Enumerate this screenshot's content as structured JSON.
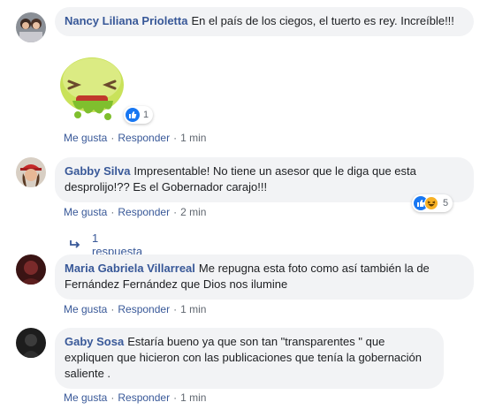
{
  "comments": [
    {
      "author": "Nancy Liliana Prioletta",
      "text": "En el país de los ciegos, el tuerto es rey. Increíble!!!",
      "sticker": "sick-face-sticker",
      "reaction_count": "1",
      "like": "Me gusta",
      "reply": "Responder",
      "time": "1 min"
    },
    {
      "author": "Gabby Silva",
      "text": "Impresentable! No tiene un asesor que le diga que esta desprolijo!?? Es el Gobernador carajo!!!",
      "reaction_count": "5",
      "like": "Me gusta",
      "reply": "Responder",
      "time": "2 min",
      "replies_label": "1 respuesta"
    },
    {
      "author": "Maria Gabriela Villarreal",
      "text": "Me repugna esta foto como así también la de Fernández Fernández que Dios nos ilumine",
      "like": "Me gusta",
      "reply": "Responder",
      "time": "1 min"
    },
    {
      "author": "Gaby Sosa",
      "text": "Estaría bueno ya que son tan \"transparentes \" que expliquen que hicieron con las publicaciones que tenía la gobernación saliente .",
      "like": "Me gusta",
      "reply": "Responder",
      "time": "1 min"
    }
  ],
  "colors": {
    "bubble": "#f2f3f5",
    "author": "#385898",
    "like_blue": "#1877f2",
    "meta": "#606770"
  }
}
